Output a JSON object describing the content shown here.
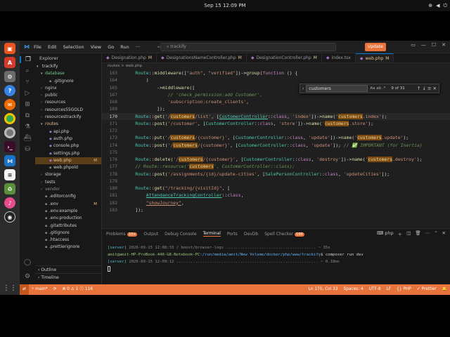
{
  "system": {
    "clock": "Sep 15  12:09 PM"
  },
  "titlebar": {
    "menus": [
      "File",
      "Edit",
      "Selection",
      "View",
      "Go",
      "Run",
      "···"
    ],
    "search_text": "trackify",
    "update_label": "Update"
  },
  "explorer": {
    "header": "Explorer",
    "project": "trackify",
    "rows": [
      {
        "label": "database",
        "indent": 1,
        "type": "folder-open",
        "cls": "git"
      },
      {
        "label": ".gitignore",
        "indent": 2,
        "type": "file",
        "cls": ""
      },
      {
        "label": "nginx",
        "indent": 1,
        "type": "folder",
        "cls": ""
      },
      {
        "label": "public",
        "indent": 1,
        "type": "folder",
        "cls": ""
      },
      {
        "label": "resources",
        "indent": 1,
        "type": "folder",
        "cls": ""
      },
      {
        "label": "resources55GOLD",
        "indent": 1,
        "type": "folder",
        "cls": ""
      },
      {
        "label": "resourcestrackify",
        "indent": 1,
        "type": "folder",
        "cls": ""
      },
      {
        "label": "routes",
        "indent": 1,
        "type": "folder-open",
        "cls": "mod"
      },
      {
        "label": "api.php",
        "indent": 2,
        "type": "php",
        "cls": ""
      },
      {
        "label": "auth.php",
        "indent": 2,
        "type": "php",
        "cls": ""
      },
      {
        "label": "console.php",
        "indent": 2,
        "type": "php",
        "cls": ""
      },
      {
        "label": "settings.php",
        "indent": 2,
        "type": "php",
        "cls": ""
      },
      {
        "label": "web.php",
        "indent": 2,
        "type": "php",
        "cls": "sel",
        "badge": "M"
      },
      {
        "label": "web.phpold",
        "indent": 2,
        "type": "file",
        "cls": ""
      },
      {
        "label": "storage",
        "indent": 1,
        "type": "folder",
        "cls": ""
      },
      {
        "label": "tests",
        "indent": 1,
        "type": "folder",
        "cls": ""
      },
      {
        "label": "vendor",
        "indent": 1,
        "type": "folder",
        "cls": "dim"
      },
      {
        "label": ".editorconfig",
        "indent": 1,
        "type": "file",
        "cls": ""
      },
      {
        "label": ".env",
        "indent": 1,
        "type": "file",
        "cls": "",
        "badge": "M"
      },
      {
        "label": ".env.example",
        "indent": 1,
        "type": "file",
        "cls": ""
      },
      {
        "label": ".env.production",
        "indent": 1,
        "type": "file",
        "cls": ""
      },
      {
        "label": ".gitattributes",
        "indent": 1,
        "type": "file",
        "cls": ""
      },
      {
        "label": ".gitignore",
        "indent": 1,
        "type": "file",
        "cls": ""
      },
      {
        "label": ".htaccess",
        "indent": 1,
        "type": "file",
        "cls": ""
      },
      {
        "label": ".prettierignore",
        "indent": 1,
        "type": "file",
        "cls": ""
      }
    ],
    "sections": [
      "Outline",
      "Timeline"
    ]
  },
  "tabs": [
    {
      "label": "Designation.php",
      "badge": "M",
      "active": false
    },
    {
      "label": "DesignationsNameController.php",
      "badge": "M",
      "active": false
    },
    {
      "label": "DesignationController.php",
      "badge": "M",
      "active": false
    },
    {
      "label": "index.tsx",
      "badge": "",
      "active": false
    },
    {
      "label": "web.php",
      "badge": "M",
      "active": true
    }
  ],
  "breadcrumb": "routes > web.php",
  "find": {
    "value": "customers",
    "options": "Aa  ab  .*",
    "count": "9 of 31",
    "arrows": "↑  ↓  ≡  ✕"
  },
  "panel": {
    "tabs": [
      {
        "label": "Problems",
        "count": "10+"
      },
      {
        "label": "Output",
        "count": ""
      },
      {
        "label": "Debug Console",
        "count": ""
      },
      {
        "label": "Terminal",
        "count": ""
      },
      {
        "label": "Ports",
        "count": ""
      },
      {
        "label": "DevDb",
        "count": ""
      },
      {
        "label": "Spell Checker",
        "count": "100"
      }
    ],
    "active_tab": "Terminal",
    "shell": "php",
    "terminal": [
      {
        "tag": "[server]",
        "text": " 2026-09-15 12:08:33 / boost/browser-logs ...................................... ~ 35s"
      },
      {
        "prompt": "amit@amit-HP-ProBook-440-G8-Notebook-PC",
        "path": ":/run/media/amit/New Volume/docker/php/www/trackify",
        "cmd": "$ composer run dev"
      },
      {
        "tag": "[server]",
        "text": " 2026-09-15 12:09:12 ............................................................ ~ 0.18ms"
      }
    ]
  },
  "status": {
    "remote": "⇄",
    "branch": "main*",
    "sync": "⟳",
    "problems": "⊗ 0  ⚠ 1  ⓘ 116",
    "right": [
      "Ln 170, Col 33",
      "Spaces: 4",
      "UTF-8",
      "LF",
      "{} PHP",
      "✓ Prettier",
      "🔔"
    ]
  }
}
